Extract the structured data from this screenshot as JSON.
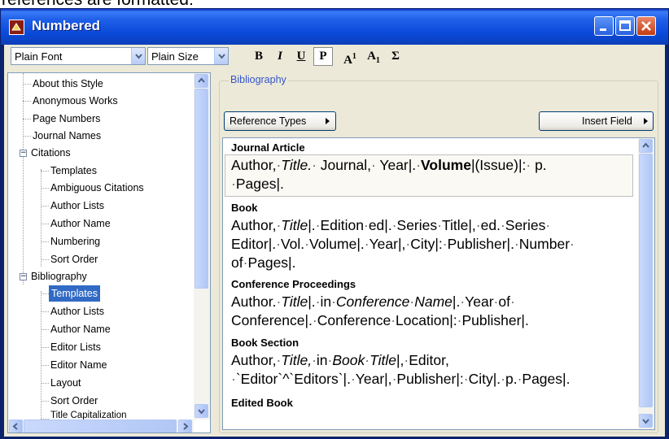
{
  "caption": "references are formatted:",
  "window": {
    "title": "Numbered"
  },
  "toolbar": {
    "font_value": "Plain Font",
    "size_value": "Plain Size",
    "buttons": {
      "bold": "B",
      "italic": "I",
      "underline": "U",
      "plain": "P",
      "superscript": "A",
      "subscript": "A",
      "sigma": "Σ"
    },
    "sup_mark": "1",
    "sub_mark": "1"
  },
  "tree": {
    "items": [
      "About this Style",
      "Anonymous Works",
      "Page Numbers",
      "Journal Names",
      "Citations",
      "Templates",
      "Ambiguous Citations",
      "Author Lists",
      "Author Name",
      "Numbering",
      "Sort Order",
      "Bibliography",
      "Templates",
      "Author Lists",
      "Author Name",
      "Editor Lists",
      "Editor Name",
      "Layout",
      "Sort Order",
      "Title Capitalization"
    ],
    "selected": "Templates"
  },
  "bibliography": {
    "group_label": "Bibliography",
    "reference_types_button": "Reference Types",
    "insert_field_button": "Insert Field",
    "templates": [
      {
        "type": "Journal Article",
        "lines": [
          [
            "Author,",
            " ",
            "Title.",
            " Journal,",
            " Year|.",
            " ",
            "Volume",
            "|(Issue)|:",
            " p."
          ],
          [
            "Pages|."
          ]
        ]
      },
      {
        "type": "Book",
        "lines": [
          [
            "Author,",
            " Title",
            "|.",
            " Edition",
            " ed|.",
            " Series",
            " Title|,",
            " ed.",
            " Series"
          ],
          [
            "Editor|.",
            " Vol.",
            " Volume|.",
            " Year|,",
            " City|:",
            " Publisher|.",
            " Number"
          ],
          [
            "of",
            " Pages|."
          ]
        ]
      },
      {
        "type": "Conference Proceedings",
        "lines": [
          [
            "Author.",
            " Title",
            "|.",
            " in",
            " Conference",
            " Name",
            "|.",
            " Year",
            " of"
          ],
          [
            "Conference|.",
            " Conference",
            " Location|:",
            " Publisher|."
          ]
        ]
      },
      {
        "type": "Book Section",
        "lines": [
          [
            "Author,",
            " Title,",
            " in",
            " Book",
            " Title",
            "|,",
            " Editor,"
          ],
          [
            "Editor`^`Editors`|.",
            " Year|,",
            " Publisher|:",
            " City|.",
            " p.",
            " Pages|."
          ]
        ]
      },
      {
        "type": "Edited Book",
        "lines": []
      }
    ]
  }
}
